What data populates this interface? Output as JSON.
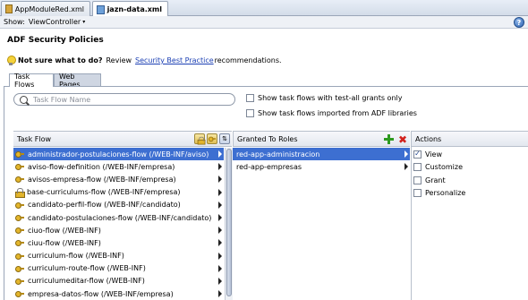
{
  "editor_tabs": [
    {
      "label": "AppModuleRed.xml",
      "active": false
    },
    {
      "label": "jazn-data.xml",
      "active": true
    }
  ],
  "showbar": {
    "label": "Show:",
    "value": "ViewController",
    "help": "?"
  },
  "title": "ADF Security Policies",
  "tip": {
    "question": "Not sure what to do?",
    "review": "Review",
    "link": "Security Best Practice",
    "suffix": "recommendations."
  },
  "page_tabs": [
    {
      "label": "Task Flows"
    },
    {
      "label": "Web Pages"
    }
  ],
  "search": {
    "placeholder": "Task Flow Name"
  },
  "options": [
    {
      "label": "Show task flows with test-all grants only",
      "checked": false
    },
    {
      "label": "Show task flows imported from ADF libraries",
      "checked": false
    }
  ],
  "headers": {
    "task_flow": "Task Flow",
    "granted": "Granted To Roles",
    "actions": "Actions"
  },
  "task_flows": [
    {
      "name": "administrador-postulaciones-flow (/WEB-INF/aviso)",
      "icon": "key",
      "selected": true
    },
    {
      "name": "aviso-flow-definition (/WEB-INF/empresa)",
      "icon": "key",
      "selected": false
    },
    {
      "name": "avisos-empresa-flow (/WEB-INF/empresa)",
      "icon": "key",
      "selected": false
    },
    {
      "name": "base-curriculums-flow (/WEB-INF/empresa)",
      "icon": "lock",
      "selected": false
    },
    {
      "name": "candidato-perfil-flow (/WEB-INF/candidato)",
      "icon": "key",
      "selected": false
    },
    {
      "name": "candidato-postulaciones-flow (/WEB-INF/candidato)",
      "icon": "key",
      "selected": false
    },
    {
      "name": "ciuo-flow (/WEB-INF)",
      "icon": "key",
      "selected": false
    },
    {
      "name": "ciuu-flow (/WEB-INF)",
      "icon": "key",
      "selected": false
    },
    {
      "name": "curriculum-flow (/WEB-INF)",
      "icon": "key",
      "selected": false
    },
    {
      "name": "curriculum-route-flow (/WEB-INF)",
      "icon": "key",
      "selected": false
    },
    {
      "name": "curriculumeditar-flow (/WEB-INF)",
      "icon": "key",
      "selected": false
    },
    {
      "name": "empresa-datos-flow (/WEB-INF/empresa)",
      "icon": "key",
      "selected": false
    }
  ],
  "roles": [
    {
      "name": "red-app-administracion",
      "selected": true
    },
    {
      "name": "red-app-empresas",
      "selected": false
    }
  ],
  "actions": [
    {
      "label": "View",
      "checked": true
    },
    {
      "label": "Customize",
      "checked": false
    },
    {
      "label": "Grant",
      "checked": false
    },
    {
      "label": "Personalize",
      "checked": false
    }
  ]
}
